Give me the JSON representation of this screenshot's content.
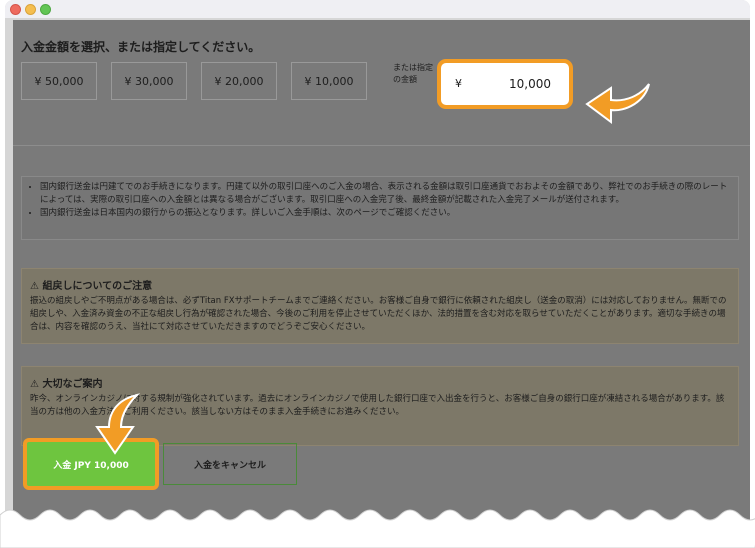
{
  "page": {
    "heading": "入金金額を選択、または指定してください。",
    "amount_options": [
      "¥ 50,000",
      "¥ 30,000",
      "¥ 20,000",
      "¥ 10,000"
    ],
    "or_label": "または指定の金額",
    "amount_input": {
      "currency": "¥",
      "value": "10,000"
    },
    "notice_items": [
      "国内銀行送金は円建てでのお手続きになります。円建て以外の取引口座へのご入金の場合、表示される金額は取引口座通貨でおおよその金額であり、弊社でのお手続きの際のレートによっては、実際の取引口座への入金額とは異なる場合がございます。取引口座への入金完了後、最終金額が記載された入金完了メールが送付されます。",
      "国内銀行送金は日本国内の銀行からの振込となります。詳しいご入金手順は、次のページでご確認ください。"
    ],
    "warning1": {
      "title": "組戻しについてのご注意",
      "body": "振込の組戻しやご不明点がある場合は、必ずTitan FXサポートチームまでご連絡ください。お客様ご自身で銀行に依頼された組戻し（送金の取消）には対応しておりません。無断での組戻しや、入金済み資金の不正な組戻し行為が確認された場合、今後のご利用を停止させていただくほか、法的措置を含む対応を取らせていただくことがあります。適切な手続きの場合は、内容を確認のうえ、当社にて対応させていただきますのでどうぞご安心ください。"
    },
    "warning2": {
      "title": "大切なご案内",
      "body": "昨今、オンラインカジノに対する規制が強化されています。過去にオンラインカジノで使用した銀行口座で入出金を行うと、お客様ご自身の銀行口座が凍結される場合があります。該当の方は他の入金方法をご利用ください。該当しない方はそのまま入金手続きにお進みください。"
    },
    "deposit_button": "入金 JPY 10,000",
    "cancel_button": "入金をキャンセル"
  },
  "colors": {
    "highlight": "#f29c25",
    "deposit_green": "#6ec53f"
  }
}
